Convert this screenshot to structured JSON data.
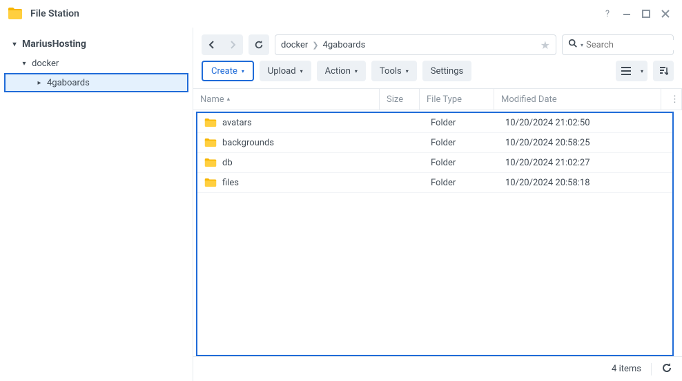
{
  "app": {
    "title": "File Station"
  },
  "sidebar": {
    "root": "MariusHosting",
    "items": [
      {
        "label": "docker"
      },
      {
        "label": "4gaboards",
        "selected": true
      }
    ]
  },
  "breadcrumb": [
    {
      "label": "docker"
    },
    {
      "label": "4gaboards"
    }
  ],
  "search": {
    "placeholder": "Search"
  },
  "toolbar": {
    "create": "Create",
    "upload": "Upload",
    "action": "Action",
    "tools": "Tools",
    "settings": "Settings"
  },
  "columns": {
    "name": "Name",
    "size": "Size",
    "type": "File Type",
    "modified": "Modified Date"
  },
  "rows": [
    {
      "name": "avatars",
      "size": "",
      "type": "Folder",
      "modified": "10/20/2024 21:02:50"
    },
    {
      "name": "backgrounds",
      "size": "",
      "type": "Folder",
      "modified": "10/20/2024 20:58:25"
    },
    {
      "name": "db",
      "size": "",
      "type": "Folder",
      "modified": "10/20/2024 21:02:27"
    },
    {
      "name": "files",
      "size": "",
      "type": "Folder",
      "modified": "10/20/2024 20:58:18"
    }
  ],
  "status": {
    "count": "4 items"
  }
}
